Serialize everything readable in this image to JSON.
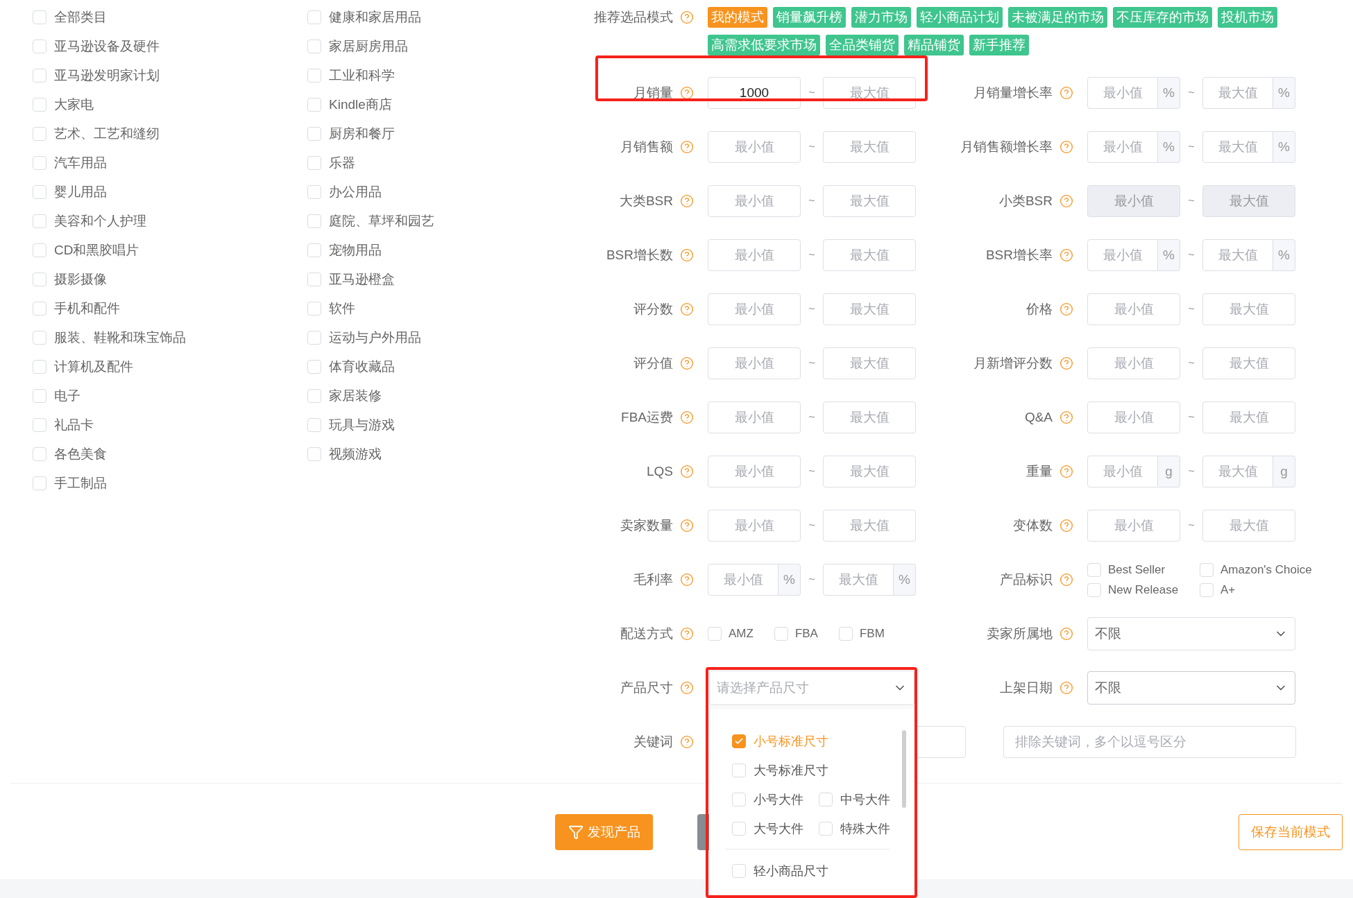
{
  "categories": {
    "columns": [
      [
        {
          "label": "全部类目",
          "checked": false
        },
        {
          "label": "亚马逊设备及硬件",
          "checked": false
        },
        {
          "label": "亚马逊发明家计划",
          "checked": false
        },
        {
          "label": "大家电",
          "checked": false
        },
        {
          "label": "艺术、工艺和缝纫",
          "checked": false
        },
        {
          "label": "汽车用品",
          "checked": false
        },
        {
          "label": "婴儿用品",
          "checked": false
        },
        {
          "label": "美容和个人护理",
          "checked": false
        },
        {
          "label": "CD和黑胶唱片",
          "checked": false
        },
        {
          "label": "摄影摄像",
          "checked": false
        },
        {
          "label": "手机和配件",
          "checked": false
        },
        {
          "label": "服装、鞋靴和珠宝饰品",
          "checked": false
        },
        {
          "label": "计算机及配件",
          "checked": false
        },
        {
          "label": "电子",
          "checked": false
        },
        {
          "label": "礼品卡",
          "checked": false
        },
        {
          "label": "各色美食",
          "checked": false
        },
        {
          "label": "手工制品",
          "checked": false
        }
      ],
      [
        {
          "label": "健康和家居用品",
          "checked": false
        },
        {
          "label": "家居厨房用品",
          "checked": false
        },
        {
          "label": "工业和科学",
          "checked": false
        },
        {
          "label": "Kindle商店",
          "checked": false
        },
        {
          "label": "厨房和餐厅",
          "checked": false
        },
        {
          "label": "乐器",
          "checked": false
        },
        {
          "label": "办公用品",
          "checked": false
        },
        {
          "label": "庭院、草坪和园艺",
          "checked": false
        },
        {
          "label": "宠物用品",
          "checked": false
        },
        {
          "label": "亚马逊橙盒",
          "checked": false
        },
        {
          "label": "软件",
          "checked": false
        },
        {
          "label": "运动与户外用品",
          "checked": false
        },
        {
          "label": "体育收藏品",
          "checked": false
        },
        {
          "label": "家居装修",
          "checked": false
        },
        {
          "label": "玩具与游戏",
          "checked": false
        },
        {
          "label": "视频游戏",
          "checked": false
        }
      ]
    ]
  },
  "mode": {
    "label": "推荐选品模式",
    "tags": [
      {
        "label": "我的模式",
        "selected": true
      },
      {
        "label": "销量飙升榜",
        "selected": false
      },
      {
        "label": "潜力市场",
        "selected": false
      },
      {
        "label": "轻小商品计划",
        "selected": false
      },
      {
        "label": "未被满足的市场",
        "selected": false
      },
      {
        "label": "不压库存的市场",
        "selected": false
      },
      {
        "label": "投机市场",
        "selected": false
      },
      {
        "label": "高需求低要求市场",
        "selected": false
      },
      {
        "label": "全品类铺货",
        "selected": false
      },
      {
        "label": "精品铺货",
        "selected": false
      },
      {
        "label": "新手推荐",
        "selected": false
      }
    ]
  },
  "filters": [
    {
      "left": {
        "label": "月销量",
        "kind": "range",
        "min": {
          "value": "1000"
        },
        "separator": "~",
        "max": {
          "placeholder": "最大值"
        },
        "disabled": false,
        "highlighted": true
      },
      "right": {
        "label": "月销量增长率",
        "kind": "range",
        "min": {
          "placeholder": "最小值",
          "suffix": "%"
        },
        "separator": "~",
        "max": {
          "placeholder": "最大值",
          "suffix": "%"
        },
        "disabled": false
      }
    },
    {
      "left": {
        "label": "月销售额",
        "kind": "range",
        "min": {
          "placeholder": "最小值"
        },
        "separator": "~",
        "max": {
          "placeholder": "最大值"
        },
        "disabled": false
      },
      "right": {
        "label": "月销售额增长率",
        "kind": "range",
        "min": {
          "placeholder": "最小值",
          "suffix": "%"
        },
        "separator": "~",
        "max": {
          "placeholder": "最大值",
          "suffix": "%"
        },
        "disabled": false
      }
    },
    {
      "left": {
        "label": "大类BSR",
        "kind": "range",
        "min": {
          "placeholder": "最小值"
        },
        "separator": "~",
        "max": {
          "placeholder": "最大值"
        },
        "disabled": false
      },
      "right": {
        "label": "小类BSR",
        "kind": "range",
        "min": {
          "placeholder": "最小值"
        },
        "separator": "~",
        "max": {
          "placeholder": "最大值"
        },
        "disabled": true
      }
    },
    {
      "left": {
        "label": "BSR增长数",
        "kind": "range",
        "min": {
          "placeholder": "最小值"
        },
        "separator": "~",
        "max": {
          "placeholder": "最大值"
        },
        "disabled": false
      },
      "right": {
        "label": "BSR增长率",
        "kind": "range",
        "min": {
          "placeholder": "最小值",
          "suffix": "%"
        },
        "separator": "~",
        "max": {
          "placeholder": "最大值",
          "suffix": "%"
        },
        "disabled": false
      }
    },
    {
      "left": {
        "label": "评分数",
        "kind": "range",
        "min": {
          "placeholder": "最小值"
        },
        "separator": "~",
        "max": {
          "placeholder": "最大值"
        },
        "disabled": false
      },
      "right": {
        "label": "价格",
        "kind": "range",
        "min": {
          "placeholder": "最小值"
        },
        "separator": "~",
        "max": {
          "placeholder": "最大值"
        },
        "disabled": false
      }
    },
    {
      "left": {
        "label": "评分值",
        "kind": "range",
        "min": {
          "placeholder": "最小值"
        },
        "separator": "~",
        "max": {
          "placeholder": "最大值"
        },
        "disabled": false
      },
      "right": {
        "label": "月新增评分数",
        "kind": "range",
        "min": {
          "placeholder": "最小值"
        },
        "separator": "~",
        "max": {
          "placeholder": "最大值"
        },
        "disabled": false
      }
    },
    {
      "left": {
        "label": "FBA运费",
        "kind": "range",
        "min": {
          "placeholder": "最小值"
        },
        "separator": "~",
        "max": {
          "placeholder": "最大值"
        },
        "disabled": false
      },
      "right": {
        "label": "Q&A",
        "kind": "range",
        "min": {
          "placeholder": "最小值"
        },
        "separator": "~",
        "max": {
          "placeholder": "最大值"
        },
        "disabled": false
      }
    },
    {
      "left": {
        "label": "LQS",
        "kind": "range",
        "min": {
          "placeholder": "最小值"
        },
        "separator": "~",
        "max": {
          "placeholder": "最大值"
        },
        "disabled": false
      },
      "right": {
        "label": "重量",
        "kind": "range",
        "min": {
          "placeholder": "最小值",
          "suffix": "g"
        },
        "separator": "~",
        "max": {
          "placeholder": "最大值",
          "suffix": "g"
        },
        "disabled": false
      }
    },
    {
      "left": {
        "label": "卖家数量",
        "kind": "range",
        "min": {
          "placeholder": "最小值"
        },
        "separator": "~",
        "max": {
          "placeholder": "最大值"
        },
        "disabled": false
      },
      "right": {
        "label": "变体数",
        "kind": "range",
        "min": {
          "placeholder": "最小值"
        },
        "separator": "~",
        "max": {
          "placeholder": "最大值"
        },
        "disabled": false
      }
    },
    {
      "left": {
        "label": "毛利率",
        "kind": "range",
        "min": {
          "placeholder": "最小值",
          "suffix": "%"
        },
        "separator": "~",
        "max": {
          "placeholder": "最大值",
          "suffix": "%"
        },
        "disabled": false
      },
      "right": {
        "label": "产品标识",
        "kind": "checkgrid",
        "options": [
          {
            "label": "Best Seller",
            "checked": false
          },
          {
            "label": "Amazon's Choice",
            "checked": false
          },
          {
            "label": "New Release",
            "checked": false
          },
          {
            "label": "A+",
            "checked": false
          }
        ]
      }
    },
    {
      "left": {
        "label": "配送方式",
        "kind": "checkline",
        "options": [
          {
            "label": "AMZ",
            "checked": false
          },
          {
            "label": "FBA",
            "checked": false
          },
          {
            "label": "FBM",
            "checked": false
          }
        ]
      },
      "right": {
        "label": "卖家所属地",
        "kind": "select",
        "value": "不限"
      }
    },
    {
      "left": {
        "label": "产品尺寸",
        "kind": "select",
        "placeholder": "请选择产品尺寸",
        "expanded": true,
        "highlighted": true,
        "option_groups": [
          [
            [
              {
                "label": "小号标准尺寸",
                "checked": true
              }
            ],
            [
              {
                "label": "大号标准尺寸",
                "checked": false
              }
            ],
            [
              {
                "label": "小号大件",
                "checked": false
              },
              {
                "label": "中号大件",
                "checked": false
              }
            ],
            [
              {
                "label": "大号大件",
                "checked": false
              },
              {
                "label": "特殊大件",
                "checked": false
              }
            ]
          ],
          [
            [
              {
                "label": "轻小商品尺寸",
                "checked": false
              }
            ]
          ]
        ]
      },
      "right": {
        "label": "上架日期",
        "kind": "select",
        "value": "不限"
      }
    },
    {
      "wide": {
        "label": "关键词",
        "kind": "keywords",
        "exclude": {
          "placeholder": "排除关键词，多个以逗号区分"
        }
      }
    }
  ],
  "buttons": {
    "discover": "发现产品",
    "save": "保存当前模式"
  }
}
